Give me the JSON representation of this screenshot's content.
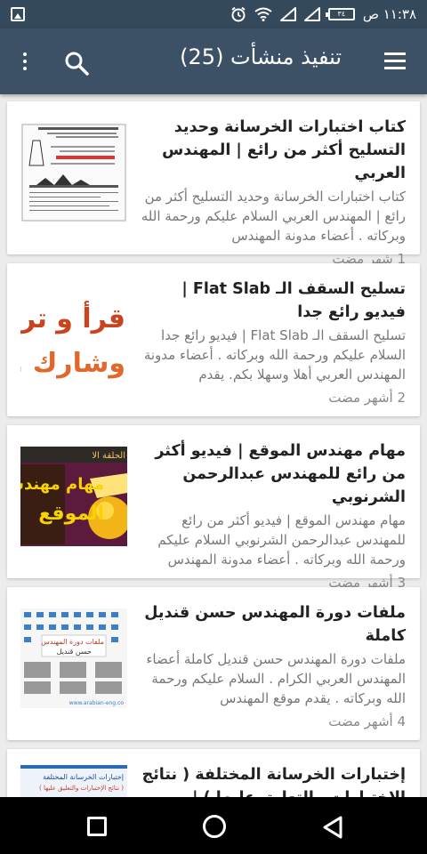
{
  "status_bar": {
    "time": "١١:٣٨ ص",
    "battery_label": "٣٤",
    "icons": [
      "gallery-icon",
      "clock-icon",
      "wifi-icon",
      "signal-icon",
      "signal-icon",
      "battery-icon"
    ]
  },
  "app_bar": {
    "title": "تنفيذ منشأت (25)",
    "icons": [
      "menu-icon",
      "search-icon",
      "more-vert-icon"
    ]
  },
  "posts": [
    {
      "title": "كتاب اختبارات الخرسانة وحديد التسليح أكثر من رائع | المهندس العربي",
      "snippet": "كتاب اختبارات الخرسانة وحديد التسليح أكثر من رائع | المهندس العربي السلام عليكم ورحمة الله وبركاته . أعضاء مدونة المهندس",
      "time": "1 شهر مضت"
    },
    {
      "title": "تسليح السقف الـ Flat Slab | فيديو رائع جدا",
      "snippet": "تسليح السقف الـ Flat Slab | فيديو رائع جدا السلام عليكم ورحمة الله وبركاته . أعضاء مدونة المهندس العربي أهلا وسهلا بكم. يقدم",
      "time": "2 أشهر مضت",
      "thumb_text": [
        "قرأ و تر",
        ". وشارك"
      ]
    },
    {
      "title": "مهام مهندس الموقع | فيديو أكثر من رائع للمهندس عبدالرحمن الشرنوبي",
      "snippet": "مهام مهندس الموقع | فيديو أكثر من رائع للمهندس عبدالرحمن الشرنوبي السلام عليكم ورحمة الله وبركاته . أعضاء مدونة المهندس",
      "time": "3 أشهر مضت",
      "thumb_text": [
        "الحلقة الا",
        "مهام مهندس",
        "الموقع"
      ]
    },
    {
      "title": "ملفات دورة المهندس حسن قنديل كاملة",
      "snippet": "ملفات دورة المهندس حسن قنديل كاملة أعضاء المهندس العربي الكرام . السلام عليكم ورحمة الله وبركاته . يقدم موقع المهندس",
      "time": "4 أشهر مضت",
      "thumb_text": [
        "ملفات دورة المهندس",
        "حسن قنديل",
        "www.arabian-eng.co"
      ]
    },
    {
      "title": "إختبارات الخرسانة المختلفة ( نتائج الإختبارات والتعليق عليها ) |",
      "thumb_text": [
        "إختبارات الخرسانة المختلفة",
        "( نتائج الإختبارات والتعليق عليها )"
      ]
    }
  ]
}
